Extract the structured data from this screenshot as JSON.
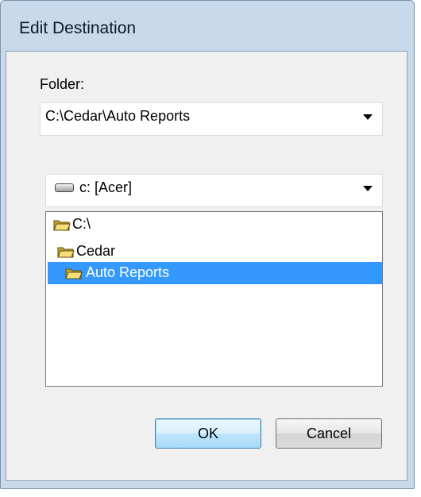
{
  "dialog": {
    "title": "Edit Destination"
  },
  "folder": {
    "label": "Folder:",
    "value": "C:\\Cedar\\Auto Reports"
  },
  "drive": {
    "value": "c: [Acer]",
    "icon": "drive-icon"
  },
  "tree": {
    "items": [
      {
        "label": "C:\\",
        "icon": "open-folder-icon",
        "level": 0,
        "selected": false
      },
      {
        "label": "Cedar",
        "icon": "open-folder-icon",
        "level": 1,
        "selected": false
      },
      {
        "label": "Auto Reports",
        "icon": "open-folder-icon",
        "level": 2,
        "selected": true
      }
    ]
  },
  "buttons": {
    "ok": "OK",
    "cancel": "Cancel"
  },
  "colors": {
    "selection": "#3399ff",
    "frame": "#c8d9ec",
    "client": "#f0f0f0"
  }
}
